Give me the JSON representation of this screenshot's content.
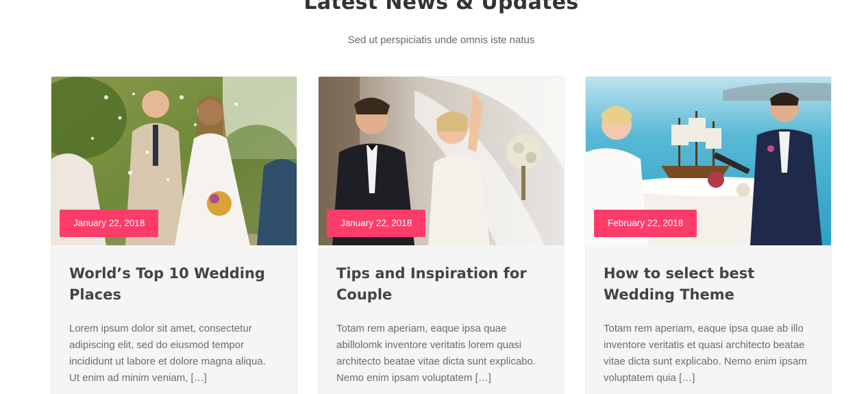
{
  "section": {
    "heading": "Latest News & Updates",
    "subheading": "Sed ut perspiciatis unde omnis iste natus"
  },
  "colors": {
    "badge": "#fe3c6a",
    "card_bg": "#f5f5f5",
    "title": "#444444",
    "text": "#6b6b6b"
  },
  "posts": [
    {
      "image": "wedding-confetti-photo",
      "date": "January 22, 2018",
      "title": "World’s Top 10 Wedding Places",
      "excerpt": "Lorem ipsum dolor sit amet, consectetur adipiscing elit, sed do eiusmod tempor incididunt ut labore et dolore magna aliqua. Ut enim ad minim veniam, […]"
    },
    {
      "image": "bride-veil-groom-photo",
      "date": "January 22, 2018",
      "title": "Tips and Inspiration for Couple",
      "excerpt": "Totam rem aperiam, eaque ipsa quae abillolomk inventore veritatis lorem quasi architecto beatae vitae dicta sunt explicabo. Nemo enim ipsam voluptatem […]"
    },
    {
      "image": "seaside-table-couple-photo",
      "date": "February 22, 2018",
      "title": "How to select best Wedding Theme",
      "excerpt": "Totam rem aperiam, eaque ipsa quae ab illo inventore veritatis et quasi architecto beatae vitae dicta sunt explicabo. Nemo enim ipsam voluptatem quia […]"
    }
  ]
}
